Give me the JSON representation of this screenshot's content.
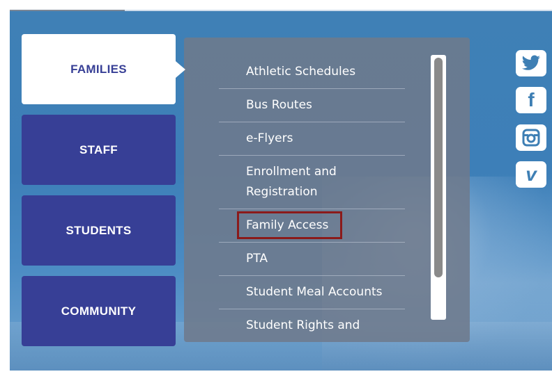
{
  "tabs": [
    {
      "label": "FAMILIES",
      "active": true
    },
    {
      "label": "STAFF",
      "active": false
    },
    {
      "label": "STUDENTS",
      "active": false
    },
    {
      "label": "COMMUNITY",
      "active": false
    }
  ],
  "menu_links": [
    "Athletic Schedules",
    "Bus Routes",
    "e-Flyers",
    "Enrollment and Registration",
    "Family Access",
    "PTA",
    "Student Meal Accounts",
    "Student Rights and"
  ],
  "highlighted_link": "Family Access",
  "social": [
    "twitter-icon",
    "facebook-icon",
    "instagram-icon",
    "vimeo-icon"
  ],
  "colors": {
    "tab_blue": "#373f96",
    "panel_gray": "#6e7a8c",
    "highlight_red": "#8b1a1a",
    "social_blue": "#3e7fb4"
  }
}
